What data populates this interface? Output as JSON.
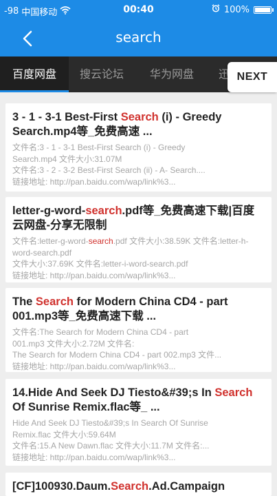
{
  "status_bar": {
    "signal": "-98",
    "carrier": "中国移动",
    "time": "00:40",
    "battery_text": "100%",
    "battery_level": 1.0
  },
  "nav": {
    "title": "search"
  },
  "tabs": [
    {
      "label": "百度网盘",
      "active": true
    },
    {
      "label": "搜云论坛",
      "active": false
    },
    {
      "label": "华为网盘",
      "active": false
    },
    {
      "label": "迅",
      "active": false
    }
  ],
  "next_label": "NEXT",
  "accent_color": "#1d8be6",
  "highlight_color": "#d0312d",
  "results": [
    {
      "title_parts": [
        "3 - 1 - 3-1 Best-First ",
        "Search",
        " (i) - Greedy Search.mp4等_免费高速 ..."
      ],
      "meta": [
        "文件名:3 - 1 - 3-1 Best-First Search (i) - Greedy",
        "Search.mp4 文件大小:31.07M",
        "文件名:3 - 2 - 3-2 Best-First Search (ii) - A- Search....",
        "链接地址: http://pan.baidu.com/wap/link%3..."
      ]
    },
    {
      "title_parts": [
        "letter-g-word-",
        "search",
        ".pdf等_免费高速下载|百度云网盘-分享无限制"
      ],
      "meta_parts": [
        "文件名:letter-g-word-",
        "search",
        ".pdf 文件大小:38.59K 文件名:letter-h-word-search.pdf"
      ],
      "meta": [
        "文件大小:37.69K 文件名:letter-i-word-search.pdf",
        "链接地址: http://pan.baidu.com/wap/link%3..."
      ]
    },
    {
      "title_parts": [
        "The ",
        "Search",
        " for Modern China CD4 - part 001.mp3等_免费高速下载 ..."
      ],
      "meta": [
        "文件名:The Search for Modern China CD4 - part",
        "001.mp3 文件大小:2.72M 文件名:",
        "The Search for Modern China CD4 - part 002.mp3 文件...",
        "链接地址: http://pan.baidu.com/wap/link%3..."
      ]
    },
    {
      "title_parts": [
        "14.Hide And Seek DJ Tiesto&#39;s In ",
        "Search",
        " Of Sunrise Remix.flac等_ ..."
      ],
      "meta": [
        "Hide And Seek DJ Tiesto&#39;s In Search Of Sunrise",
        "Remix.flac 文件大小:59.64M",
        "文件名:15.A New Dawn.flac 文件大小:11.7M 文件名:...",
        "链接地址: http://pan.baidu.com/wap/link%3..."
      ]
    },
    {
      "title_parts": [
        "[CF]100930.Daum.",
        "Search",
        ".Ad.Campaign"
      ],
      "meta": []
    }
  ]
}
